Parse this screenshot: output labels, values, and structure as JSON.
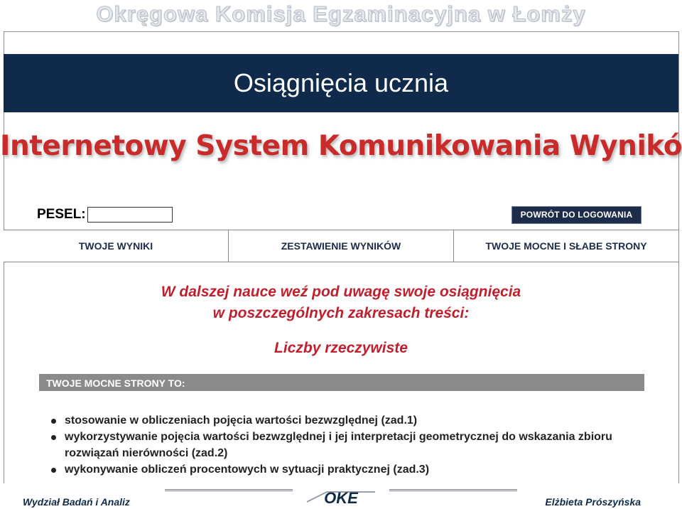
{
  "banner": {
    "text": "Okręgowa Komisja Egzaminacyjna w Łomży"
  },
  "slide": {
    "title": "Osiągnięcia ucznia"
  },
  "system": {
    "heading": "Internetowy System Komunikowania Wyników"
  },
  "login": {
    "pesel_label": "PESEL:",
    "pesel_value": "",
    "back_button": "POWRÓT DO LOGOWANIA"
  },
  "tabs": [
    {
      "label": "TWOJE WYNIKI"
    },
    {
      "label": "ZESTAWIENIE WYNIKÓW"
    },
    {
      "label": "TWOJE MOCNE I SŁABE STRONY"
    }
  ],
  "content": {
    "intro_line1": "W dalszej nauce weź pod uwagę swoje osiągnięcia",
    "intro_line2": "w poszczególnych zakresach treści:",
    "topic": "Liczby rzeczywiste",
    "strengths_header": "TWOJE MOCNE STRONY TO:",
    "strengths": [
      "stosowanie w obliczeniach pojęcia wartości bezwzględnej (zad.1)",
      "wykorzystywanie pojęcia wartości bezwzględnej i jej interpretacji geometrycznej do wskazania zbioru rozwiązań nierówności (zad.2)",
      "wykonywanie obliczeń procentowych w sytuacji praktycznej (zad.3)"
    ]
  },
  "footer": {
    "left": "Wydział Badań i Analiz",
    "logo_text": "OKE",
    "right": "Elżbieta Prószyńska"
  },
  "colors": {
    "navy": "#0f2a4a",
    "accent_red": "#c01f2e",
    "bar_gray": "#8a8a8a"
  }
}
